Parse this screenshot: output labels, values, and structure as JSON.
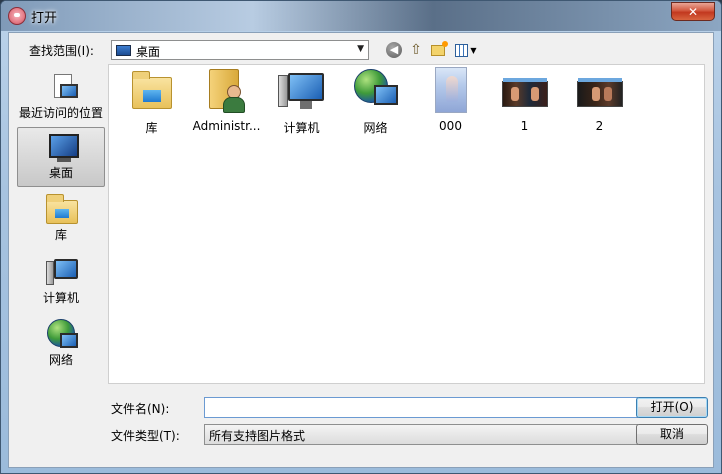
{
  "window": {
    "title": "打开",
    "close_label": "✕"
  },
  "toolbar": {
    "look_in_label": "查找范围(I):",
    "look_in_value": "桌面"
  },
  "places": [
    {
      "label": "最近访问的位置"
    },
    {
      "label": "桌面"
    },
    {
      "label": "库"
    },
    {
      "label": "计算机"
    },
    {
      "label": "网络"
    }
  ],
  "files": [
    {
      "label": "库",
      "icon": "library-folder-icon"
    },
    {
      "label": "Administr...",
      "icon": "user-folder-icon"
    },
    {
      "label": "计算机",
      "icon": "computer-icon"
    },
    {
      "label": "网络",
      "icon": "network-icon"
    },
    {
      "label": "000",
      "icon": "image-thumbnail-icon"
    },
    {
      "label": "1",
      "icon": "image-thumbnail-icon"
    },
    {
      "label": "2",
      "icon": "image-thumbnail-icon"
    }
  ],
  "bottom": {
    "filename_label": "文件名(N):",
    "filename_value": "",
    "filetype_label": "文件类型(T):",
    "filetype_value": "所有支持图片格式",
    "open_label": "打开(O)",
    "cancel_label": "取消"
  }
}
